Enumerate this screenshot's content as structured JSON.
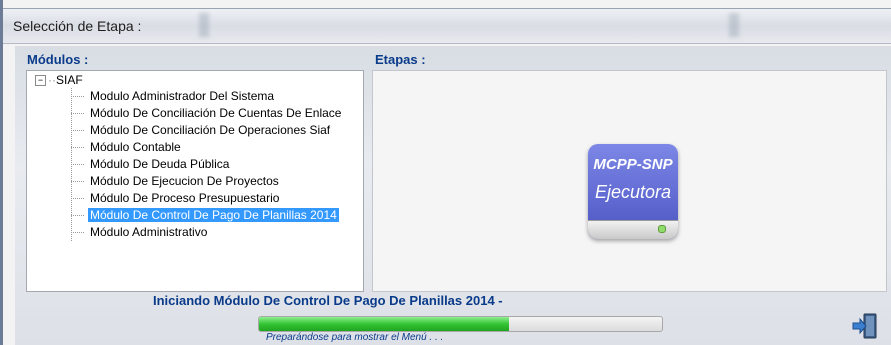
{
  "window": {
    "title": "Selección de Etapa :"
  },
  "modules": {
    "label": "Módulos :",
    "root": "SIAF",
    "items": [
      {
        "label": "Modulo Administrador Del Sistema",
        "selected": false
      },
      {
        "label": "Módulo De Conciliación De Cuentas De Enlace",
        "selected": false
      },
      {
        "label": "Módulo De Conciliación De Operaciones Siaf",
        "selected": false
      },
      {
        "label": "Módulo Contable",
        "selected": false
      },
      {
        "label": "Módulo De Deuda Pública",
        "selected": false
      },
      {
        "label": "Módulo De Ejecucion De Proyectos",
        "selected": false
      },
      {
        "label": "Módulo De Proceso Presupuestario",
        "selected": false
      },
      {
        "label": "Módulo De Control De Pago De Planillas 2014",
        "selected": true
      },
      {
        "label": "Módulo Administrativo",
        "selected": false
      }
    ]
  },
  "stages": {
    "label": "Etapas :",
    "icon": "drive-icon",
    "line1": "MCPP-SNP",
    "line2": "Ejecutora"
  },
  "status": {
    "message": "Iniciando Módulo De Control De Pago De Planillas 2014 -",
    "progress": 0.62,
    "sub": "Preparándose para mostrar el Menú . . .",
    "exit_icon": "exit-icon"
  },
  "colors": {
    "accent": "#0a3b8a",
    "selection": "#3399ff",
    "progress": "#35c435"
  }
}
